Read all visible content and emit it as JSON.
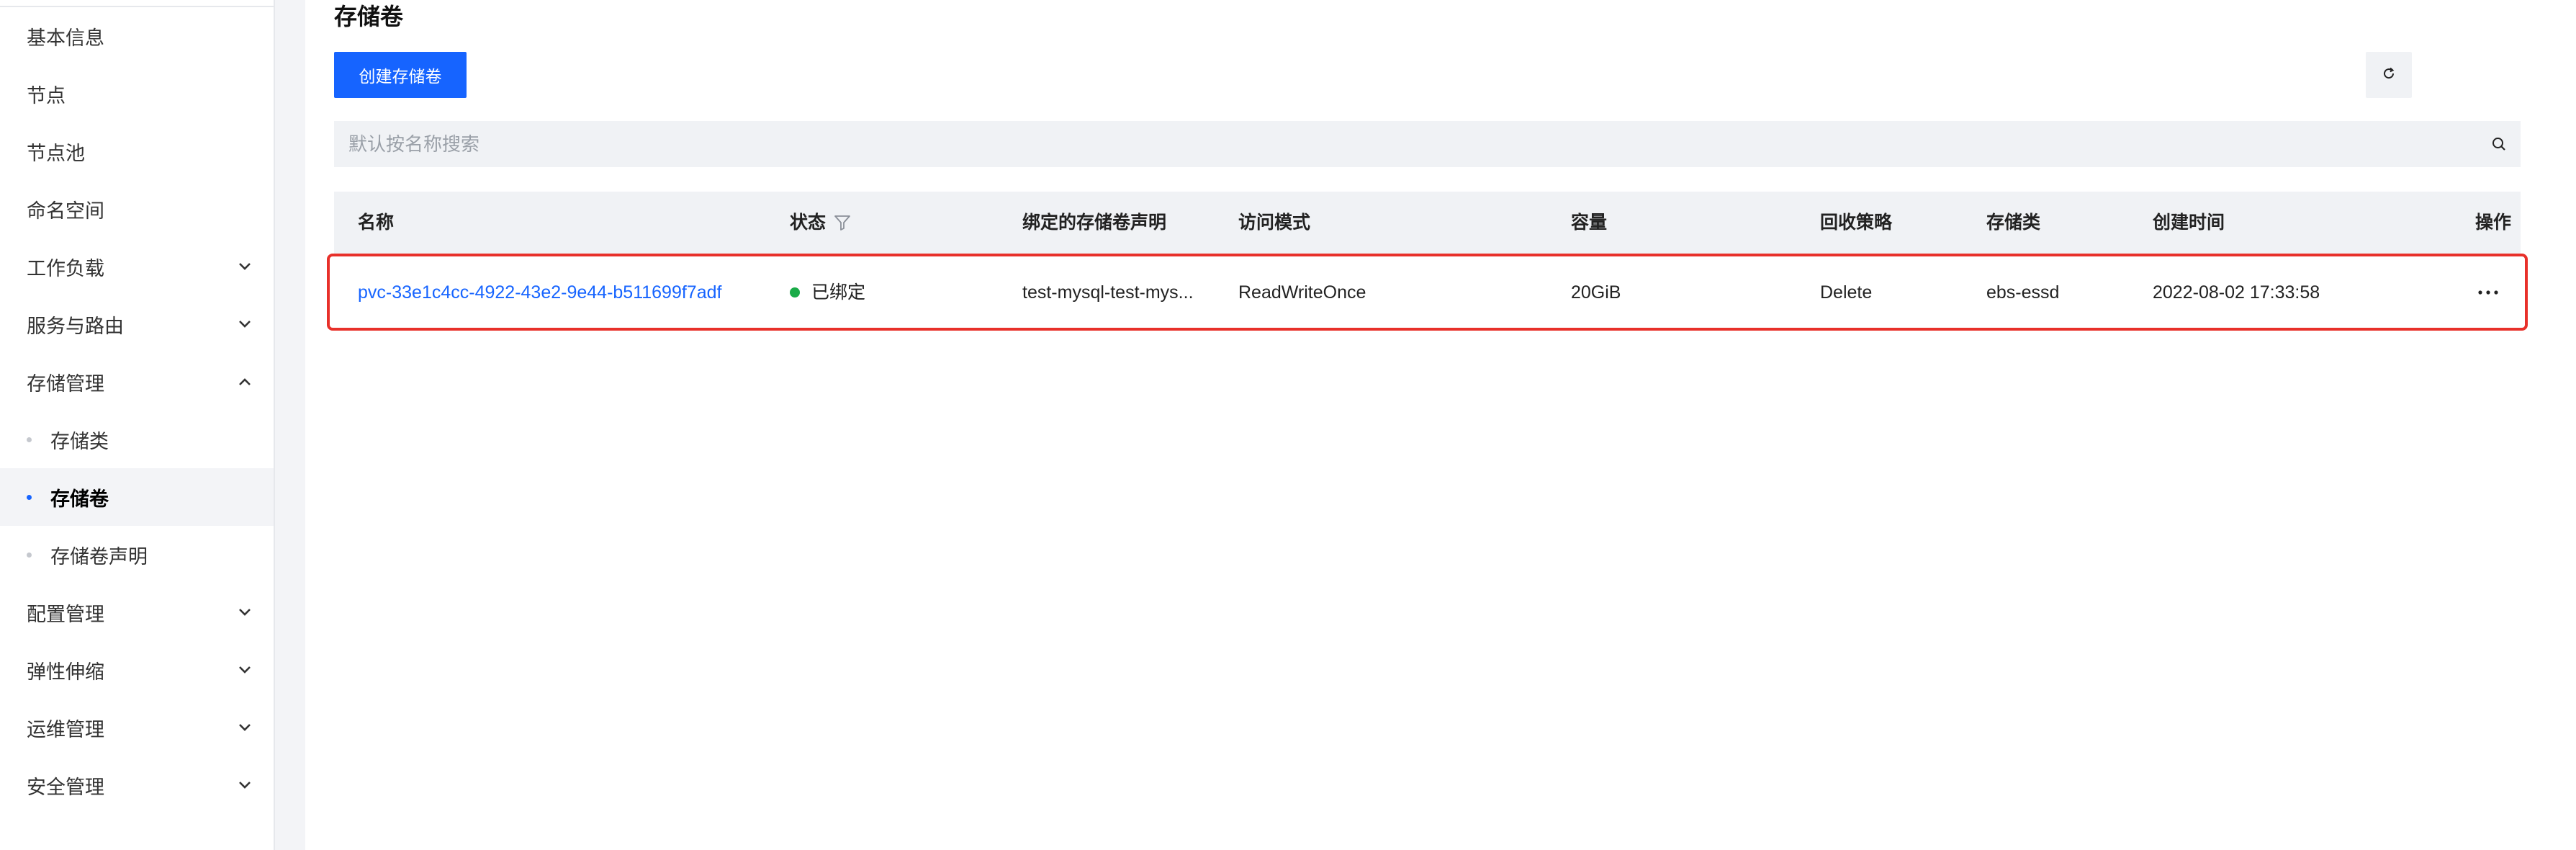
{
  "sidebar": {
    "items": [
      {
        "label": "基本信息"
      },
      {
        "label": "节点"
      },
      {
        "label": "节点池"
      },
      {
        "label": "命名空间"
      },
      {
        "label": "工作负载"
      },
      {
        "label": "服务与路由"
      },
      {
        "label": "存储管理"
      },
      {
        "label": "存储类"
      },
      {
        "label": "存储卷"
      },
      {
        "label": "存储卷声明"
      },
      {
        "label": "配置管理"
      },
      {
        "label": "弹性伸缩"
      },
      {
        "label": "运维管理"
      },
      {
        "label": "安全管理"
      }
    ],
    "active_item": "存储卷"
  },
  "main": {
    "title": "存储卷",
    "create_button": "创建存储卷",
    "search": {
      "placeholder": "默认按名称搜索",
      "value": ""
    },
    "table": {
      "columns": [
        "名称",
        "状态",
        "绑定的存储卷声明",
        "访问模式",
        "容量",
        "回收策略",
        "存储类",
        "创建时间",
        "操作"
      ],
      "rows": [
        {
          "name": "pvc-33e1c4cc-4922-43e2-9e44-b511699f7adf",
          "status": "已绑定",
          "claim": "test-mysql-test-mys...",
          "access_mode": "ReadWriteOnce",
          "capacity": "20GiB",
          "reclaim_policy": "Delete",
          "storage_class": "ebs-essd",
          "created": "2022-08-02 17:33:58"
        }
      ]
    }
  },
  "colors": {
    "accent": "#1664ff",
    "status_bound": "#1aab48",
    "highlight_border": "#e8302a"
  },
  "icons": [
    "chevron-down-icon",
    "chevron-up-icon",
    "refresh-icon",
    "search-icon",
    "filter-icon",
    "more-icon"
  ]
}
